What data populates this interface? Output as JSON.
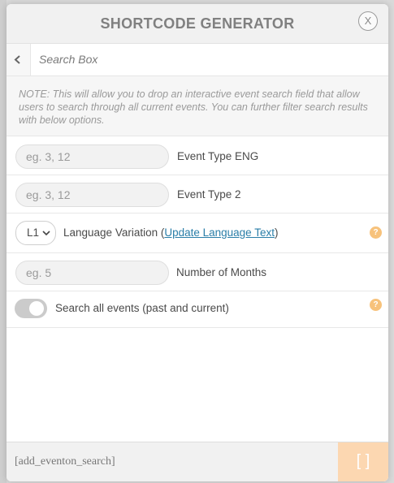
{
  "header": {
    "title": "SHORTCODE GENERATOR",
    "close_label": "X"
  },
  "subheader": {
    "title": "Search Box"
  },
  "note": "NOTE: This will allow you to drop an interactive event search field that allow users to search through all current events. You can further filter search results with below options.",
  "fields": [
    {
      "placeholder": "eg. 3, 12",
      "label": "Event Type ENG"
    },
    {
      "placeholder": "eg. 3, 12",
      "label": "Event Type 2"
    }
  ],
  "language": {
    "selected": "L1",
    "label_prefix": "Language Variation (",
    "link_text": "Update Language Text",
    "label_suffix": ")",
    "help": "?"
  },
  "months": {
    "placeholder": "eg. 5",
    "label": "Number of Months"
  },
  "toggle": {
    "label": "Search all events (past and current)",
    "help": "?",
    "state": "off"
  },
  "footer": {
    "code": "[add_eventon_search]",
    "copy_label": "[ ]"
  },
  "colors": {
    "accent": "#f7c27b",
    "link": "#2a7ea8",
    "copy_button": "#fcd7b1"
  }
}
